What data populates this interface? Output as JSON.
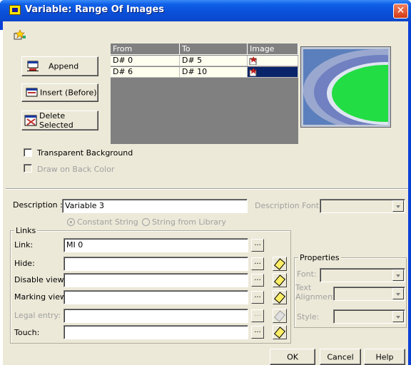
{
  "window": {
    "title": "Variable: Range Of Images",
    "close_label": "✕"
  },
  "toolbar": {
    "append_label": "Append",
    "insert_label": "Insert (Before)",
    "delete_label": "Delete Selected"
  },
  "ranges_table": {
    "columns": [
      "From",
      "To",
      "Image"
    ],
    "rows": [
      {
        "from": "D# 0",
        "to": "D# 5"
      },
      {
        "from": "D# 6",
        "to": "D# 10"
      }
    ]
  },
  "options": {
    "transparent_background_label": "Transparent Background",
    "draw_on_back_color_label": "Draw on Back Color"
  },
  "description": {
    "label": "Description :",
    "value": "Variable 3",
    "font_label": "Description Font:",
    "font_value": "",
    "constant_string_label": "Constant String",
    "string_from_library_label": "String from Library"
  },
  "links": {
    "legend": "Links",
    "rows": [
      {
        "label": "Link:",
        "value": "MI 0"
      },
      {
        "label": "Hide:",
        "value": ""
      },
      {
        "label": "Disable view:",
        "value": ""
      },
      {
        "label": "Marking view:",
        "value": ""
      },
      {
        "label": "Legal entry:",
        "value": ""
      },
      {
        "label": "Touch:",
        "value": ""
      }
    ],
    "browse_label": "..."
  },
  "properties": {
    "legend": "Properties",
    "font_label": "Font:",
    "text_alignment_label_1": "Text",
    "text_alignment_label_2": "Alignment",
    "style_label": "Style:"
  },
  "footer": {
    "ok_label": "OK",
    "cancel_label": "Cancel",
    "help_label": "Help"
  },
  "colors": {
    "title_bar": "#0a4fd8",
    "dialog_bg": "#ece9d8",
    "preview_bg": "#5a7fbc",
    "preview_ellipse": "#22dd44",
    "selection": "#0a246a"
  }
}
